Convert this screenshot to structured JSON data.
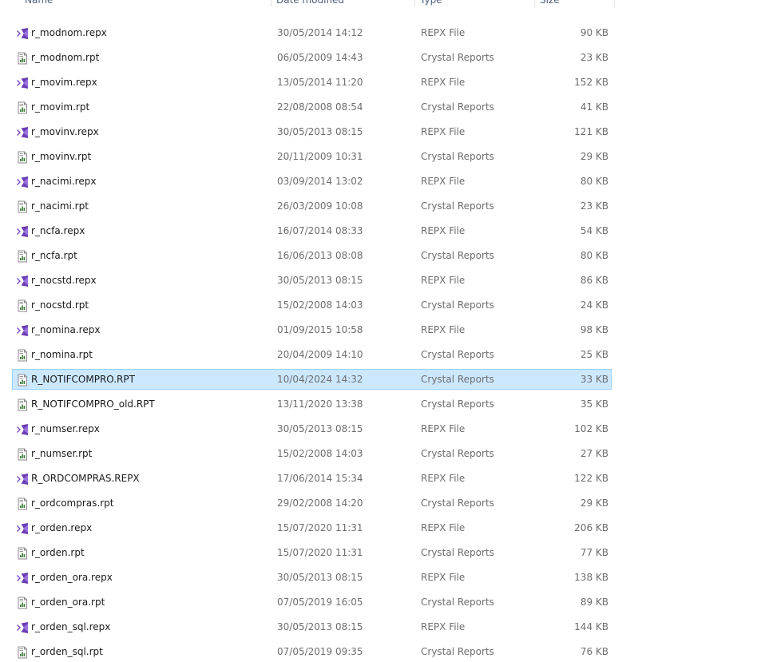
{
  "header": {
    "name": "Name",
    "date": "Date modified",
    "type": "Type",
    "size": "Size"
  },
  "files": [
    {
      "name": "r_modnom.repx",
      "date": "30/05/2014 14:12",
      "type": "REPX File",
      "size": "90 KB",
      "icon": "repx-file-icon",
      "selected": false
    },
    {
      "name": "r_modnom.rpt",
      "date": "06/05/2009 14:43",
      "type": "Crystal Reports",
      "size": "23 KB",
      "icon": "rpt-file-icon",
      "selected": false
    },
    {
      "name": "r_movim.repx",
      "date": "13/05/2014 11:20",
      "type": "REPX File",
      "size": "152 KB",
      "icon": "repx-file-icon",
      "selected": false
    },
    {
      "name": "r_movim.rpt",
      "date": "22/08/2008 08:54",
      "type": "Crystal Reports",
      "size": "41 KB",
      "icon": "rpt-file-icon",
      "selected": false
    },
    {
      "name": "r_movinv.repx",
      "date": "30/05/2013 08:15",
      "type": "REPX File",
      "size": "121 KB",
      "icon": "repx-file-icon",
      "selected": false
    },
    {
      "name": "r_movinv.rpt",
      "date": "20/11/2009 10:31",
      "type": "Crystal Reports",
      "size": "29 KB",
      "icon": "rpt-file-icon",
      "selected": false
    },
    {
      "name": "r_nacimi.repx",
      "date": "03/09/2014 13:02",
      "type": "REPX File",
      "size": "80 KB",
      "icon": "repx-file-icon",
      "selected": false
    },
    {
      "name": "r_nacimi.rpt",
      "date": "26/03/2009 10:08",
      "type": "Crystal Reports",
      "size": "23 KB",
      "icon": "rpt-file-icon",
      "selected": false
    },
    {
      "name": "r_ncfa.repx",
      "date": "16/07/2014 08:33",
      "type": "REPX File",
      "size": "54 KB",
      "icon": "repx-file-icon",
      "selected": false
    },
    {
      "name": "r_ncfa.rpt",
      "date": "16/06/2013 08:08",
      "type": "Crystal Reports",
      "size": "80 KB",
      "icon": "rpt-file-icon",
      "selected": false
    },
    {
      "name": "r_nocstd.repx",
      "date": "30/05/2013 08:15",
      "type": "REPX File",
      "size": "86 KB",
      "icon": "repx-file-icon",
      "selected": false
    },
    {
      "name": "r_nocstd.rpt",
      "date": "15/02/2008 14:03",
      "type": "Crystal Reports",
      "size": "24 KB",
      "icon": "rpt-file-icon",
      "selected": false
    },
    {
      "name": "r_nomina.repx",
      "date": "01/09/2015 10:58",
      "type": "REPX File",
      "size": "98 KB",
      "icon": "repx-file-icon",
      "selected": false
    },
    {
      "name": "r_nomina.rpt",
      "date": "20/04/2009 14:10",
      "type": "Crystal Reports",
      "size": "25 KB",
      "icon": "rpt-file-icon",
      "selected": false
    },
    {
      "name": "R_NOTIFCOMPRO.RPT",
      "date": "10/04/2024 14:32",
      "type": "Crystal Reports",
      "size": "33 KB",
      "icon": "rpt-file-icon",
      "selected": true
    },
    {
      "name": "R_NOTIFCOMPRO_old.RPT",
      "date": "13/11/2020 13:38",
      "type": "Crystal Reports",
      "size": "35 KB",
      "icon": "rpt-file-icon",
      "selected": false
    },
    {
      "name": "r_numser.repx",
      "date": "30/05/2013 08:15",
      "type": "REPX File",
      "size": "102 KB",
      "icon": "repx-file-icon",
      "selected": false
    },
    {
      "name": "r_numser.rpt",
      "date": "15/02/2008 14:03",
      "type": "Crystal Reports",
      "size": "27 KB",
      "icon": "rpt-file-icon",
      "selected": false
    },
    {
      "name": "R_ORDCOMPRAS.REPX",
      "date": "17/06/2014 15:34",
      "type": "REPX File",
      "size": "122 KB",
      "icon": "repx-file-icon",
      "selected": false
    },
    {
      "name": "r_ordcompras.rpt",
      "date": "29/02/2008 14:20",
      "type": "Crystal Reports",
      "size": "29 KB",
      "icon": "rpt-file-icon",
      "selected": false
    },
    {
      "name": "r_orden.repx",
      "date": "15/07/2020 11:31",
      "type": "REPX File",
      "size": "206 KB",
      "icon": "repx-file-icon",
      "selected": false
    },
    {
      "name": "r_orden.rpt",
      "date": "15/07/2020 11:31",
      "type": "Crystal Reports",
      "size": "77 KB",
      "icon": "rpt-file-icon",
      "selected": false
    },
    {
      "name": "r_orden_ora.repx",
      "date": "30/05/2013 08:15",
      "type": "REPX File",
      "size": "138 KB",
      "icon": "repx-file-icon",
      "selected": false
    },
    {
      "name": "r_orden_ora.rpt",
      "date": "07/05/2019 16:05",
      "type": "Crystal Reports",
      "size": "89 KB",
      "icon": "rpt-file-icon",
      "selected": false
    },
    {
      "name": "r_orden_sql.repx",
      "date": "30/05/2013 08:15",
      "type": "REPX File",
      "size": "144 KB",
      "icon": "repx-file-icon",
      "selected": false
    },
    {
      "name": "r_orden_sql.rpt",
      "date": "07/05/2019 09:35",
      "type": "Crystal Reports",
      "size": "76 KB",
      "icon": "rpt-file-icon",
      "selected": false
    }
  ],
  "colors": {
    "selection_bg": "#cce8ff",
    "selection_border": "#99d1ff",
    "repx_icon": "#7b4fc9",
    "rpt_icon": "#3f7d3a"
  }
}
